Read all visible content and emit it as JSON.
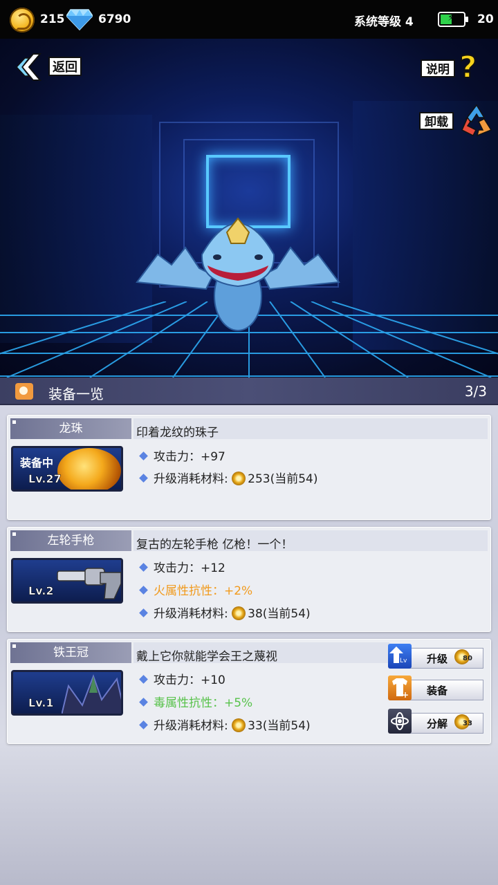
{
  "top_bar": {
    "coins": "215",
    "gems": "6790",
    "system_level": "系统等级 4",
    "battery": "20",
    "coin_icon": "gold-coin-icon",
    "gem_icon": "diamond-icon",
    "battery_color": "#2fd14b"
  },
  "scene": {
    "back_label": "返回",
    "help_label": "说明",
    "help_symbol": "?",
    "unload_label": "卸载"
  },
  "section": {
    "title": "装备一览",
    "count": "3/3"
  },
  "equipment": [
    {
      "name": "龙珠",
      "description": "印着龙纹的珠子",
      "status": "装备中",
      "level": "Lv.27",
      "stats": [
        {
          "text": "攻击力：+97",
          "type": "normal"
        },
        {
          "text": "升级消耗材料: ",
          "value": "253(当前54)",
          "type": "material"
        }
      ]
    },
    {
      "name": "左轮手枪",
      "description": "复古的左轮手枪 亿枪！一个！",
      "level": "Lv.2",
      "stats": [
        {
          "text": "攻击力：+12",
          "type": "normal"
        },
        {
          "text": "火属性抗性：+2%",
          "type": "fire"
        },
        {
          "text": "升级消耗材料: ",
          "value": "38(当前54)",
          "type": "material"
        }
      ]
    },
    {
      "name": "铁王冠",
      "description": "戴上它你就能学会王之蔑视",
      "level": "Lv.1",
      "stats": [
        {
          "text": "攻击力：+10",
          "type": "normal"
        },
        {
          "text": "毒属性抗性：+5%",
          "type": "poison"
        },
        {
          "text": "升级消耗材料: ",
          "value": "33(当前54)",
          "type": "material"
        }
      ],
      "actions": {
        "upgrade_label": "升级",
        "upgrade_cost": "80",
        "equip_label": "装备",
        "decompose_label": "分解",
        "decompose_cost": "33",
        "upgrade_icon_sub": "Lv"
      }
    }
  ],
  "colors": {
    "fire": "#f19a1c",
    "poison": "#57c24a",
    "accent": "#5a83e2"
  }
}
